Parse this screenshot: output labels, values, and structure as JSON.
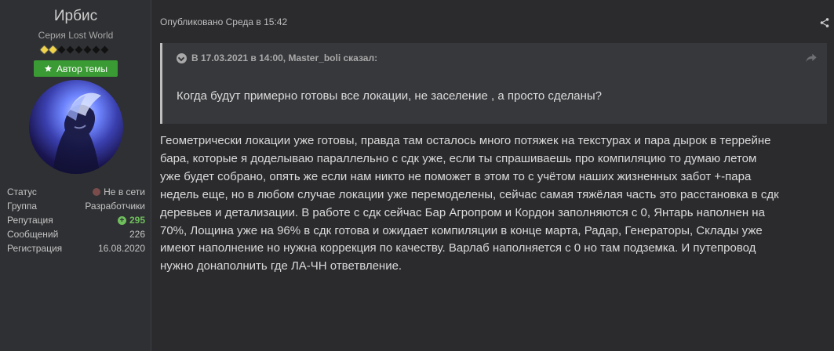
{
  "author": {
    "name": "Ирбис",
    "rank_title": "Серия Lost World",
    "rank_pips": {
      "filled": 2,
      "total": 8
    },
    "badge": "Автор темы",
    "stats": [
      {
        "label": "Статус",
        "value": "Не в сети",
        "kind": "status"
      },
      {
        "label": "Группа",
        "value": "Разработчики",
        "kind": "text"
      },
      {
        "label": "Репутация",
        "value": "295",
        "kind": "reputation"
      },
      {
        "label": "Сообщений",
        "value": "226",
        "kind": "text"
      },
      {
        "label": "Регистрация",
        "value": "16.08.2020",
        "kind": "text"
      }
    ]
  },
  "post": {
    "meta": "Опубликовано Среда в 15:42",
    "quote": {
      "header": "В 17.03.2021 в 14:00, Master_boli сказал:",
      "text": "Когда будут примерно готовы все локации, не заселение , а просто сделаны?"
    },
    "body_lines": [
      "Геометрически локации уже готовы, правда там осталось много потяжек на текстурах и пара дырок в террейне",
      "бара, которые я доделываю параллельно с сдк уже, если ты спрашиваешь про компиляцию то думаю летом",
      "уже будет собрано, опять же если нам никто не поможет в этом то с учётом наших жизненных забот +-пара",
      "недель еще, но в любом случае локации уже перемоделены, сейчас самая тяжёлая часть это расстановка в сдк",
      "деревьев и детализации. В работе с сдк сейчас Бар Агропром и Кордон заполняются с 0, Янтарь наполнен на",
      "70%, Лощина уже на 96% в сдк готова и ожидает компиляции в конце марта, Радар, Генераторы, Склады уже",
      "имеют наполнение но нужна коррекция по качеству. Варлаб наполняется с 0 но там подземка. И путепровод",
      "нужно донаполнить где ЛА-ЧН ответвление."
    ]
  },
  "colors": {
    "background": "#2b2b2e",
    "sidebar": "#2f3033",
    "badge": "#3a9a33",
    "reputation": "#6fbf5d",
    "quote_bg": "#37383c",
    "pip_on": "#f0d34a"
  },
  "icons": [
    "star-icon",
    "share-icon",
    "chevron-down-icon",
    "reply-arrow-icon",
    "plus-circle-icon",
    "offline-dot-icon"
  ]
}
